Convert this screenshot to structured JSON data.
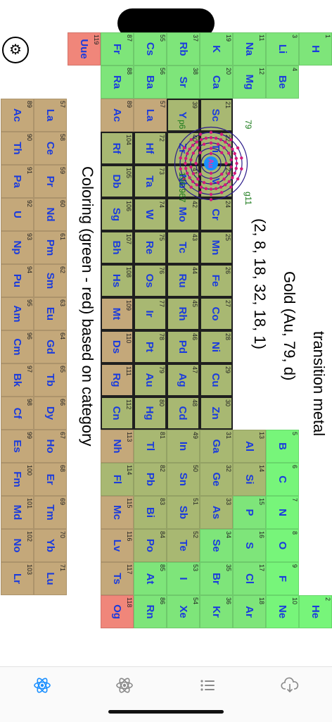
{
  "colors": {
    "green": "#7ee57a",
    "olive": "#a8b872",
    "tan": "#c4a87a",
    "salmon": "#f0867a",
    "brightgreen": "#77f57a",
    "highlightgreen": "#bfd07e",
    "accent": "#1a8fff",
    "symbol": "#1a3bdd"
  },
  "settings": {
    "icon": "gear-icon",
    "glyph": "⚙"
  },
  "selected": {
    "category": "transition metal",
    "title": "Gold (Au, 79, d)",
    "config": "(2, 8, 18, 32, 18, 1)",
    "atom": {
      "symbol": "Au",
      "number": "79",
      "mass": "196.967",
      "period": "p6",
      "group": "g11",
      "shells": [
        2,
        8,
        18,
        32,
        18,
        1
      ]
    }
  },
  "legend": "Coloring (green - red) based on category",
  "elements": [
    {
      "n": "1",
      "s": "H",
      "c": "green"
    },
    {
      "n": "2",
      "s": "He",
      "c": "brightgreen"
    },
    {
      "n": "3",
      "s": "Li",
      "c": "green"
    },
    {
      "n": "4",
      "s": "Be",
      "c": "green"
    },
    {
      "n": "5",
      "s": "B",
      "c": "brightgreen"
    },
    {
      "n": "6",
      "s": "C",
      "c": "brightgreen"
    },
    {
      "n": "7",
      "s": "N",
      "c": "brightgreen"
    },
    {
      "n": "8",
      "s": "O",
      "c": "brightgreen"
    },
    {
      "n": "9",
      "s": "F",
      "c": "brightgreen"
    },
    {
      "n": "10",
      "s": "Ne",
      "c": "brightgreen"
    },
    {
      "n": "11",
      "s": "Na",
      "c": "green"
    },
    {
      "n": "12",
      "s": "Mg",
      "c": "green"
    },
    {
      "n": "13",
      "s": "Al",
      "c": "olive"
    },
    {
      "n": "14",
      "s": "Si",
      "c": "olive"
    },
    {
      "n": "15",
      "s": "P",
      "c": "green"
    },
    {
      "n": "16",
      "s": "S",
      "c": "green"
    },
    {
      "n": "17",
      "s": "Cl",
      "c": "green"
    },
    {
      "n": "18",
      "s": "Ar",
      "c": "green"
    },
    {
      "n": "19",
      "s": "K",
      "c": "green"
    },
    {
      "n": "20",
      "s": "Ca",
      "c": "green"
    },
    {
      "n": "21",
      "s": "Sc",
      "c": "olive"
    },
    {
      "n": "22",
      "s": "Ti",
      "c": "olive"
    },
    {
      "n": "23",
      "s": "V",
      "c": "olive"
    },
    {
      "n": "24",
      "s": "Cr",
      "c": "olive"
    },
    {
      "n": "25",
      "s": "Mn",
      "c": "olive"
    },
    {
      "n": "26",
      "s": "Fe",
      "c": "olive"
    },
    {
      "n": "27",
      "s": "Co",
      "c": "olive"
    },
    {
      "n": "28",
      "s": "Ni",
      "c": "olive"
    },
    {
      "n": "29",
      "s": "Cu",
      "c": "olive"
    },
    {
      "n": "30",
      "s": "Zn",
      "c": "olive"
    },
    {
      "n": "31",
      "s": "Ga",
      "c": "olive"
    },
    {
      "n": "32",
      "s": "Ge",
      "c": "olive"
    },
    {
      "n": "33",
      "s": "As",
      "c": "olive"
    },
    {
      "n": "34",
      "s": "Se",
      "c": "green"
    },
    {
      "n": "35",
      "s": "Br",
      "c": "green"
    },
    {
      "n": "36",
      "s": "Kr",
      "c": "green"
    },
    {
      "n": "37",
      "s": "Rb",
      "c": "green"
    },
    {
      "n": "38",
      "s": "Sr",
      "c": "green"
    },
    {
      "n": "39",
      "s": "Y",
      "c": "olive"
    },
    {
      "n": "40",
      "s": "Zr",
      "c": "olive"
    },
    {
      "n": "41",
      "s": "Nb",
      "c": "olive"
    },
    {
      "n": "42",
      "s": "Mo",
      "c": "olive"
    },
    {
      "n": "43",
      "s": "Tc",
      "c": "olive"
    },
    {
      "n": "44",
      "s": "Ru",
      "c": "olive"
    },
    {
      "n": "45",
      "s": "Rh",
      "c": "olive"
    },
    {
      "n": "46",
      "s": "Pd",
      "c": "olive"
    },
    {
      "n": "47",
      "s": "Ag",
      "c": "olive"
    },
    {
      "n": "48",
      "s": "Cd",
      "c": "olive"
    },
    {
      "n": "49",
      "s": "In",
      "c": "olive"
    },
    {
      "n": "50",
      "s": "Sn",
      "c": "olive"
    },
    {
      "n": "51",
      "s": "Sb",
      "c": "olive"
    },
    {
      "n": "52",
      "s": "Te",
      "c": "olive"
    },
    {
      "n": "53",
      "s": "I",
      "c": "green"
    },
    {
      "n": "54",
      "s": "Xe",
      "c": "green"
    },
    {
      "n": "55",
      "s": "Cs",
      "c": "green"
    },
    {
      "n": "56",
      "s": "Ba",
      "c": "green"
    },
    {
      "n": "57",
      "s": "La",
      "c": "tan"
    },
    {
      "n": "72",
      "s": "Hf",
      "c": "olive"
    },
    {
      "n": "73",
      "s": "Ta",
      "c": "olive"
    },
    {
      "n": "74",
      "s": "W",
      "c": "olive"
    },
    {
      "n": "75",
      "s": "Re",
      "c": "olive"
    },
    {
      "n": "76",
      "s": "Os",
      "c": "olive"
    },
    {
      "n": "77",
      "s": "Ir",
      "c": "olive"
    },
    {
      "n": "78",
      "s": "Pt",
      "c": "olive"
    },
    {
      "n": "79",
      "s": "Au",
      "c": "olive"
    },
    {
      "n": "80",
      "s": "Hg",
      "c": "olive"
    },
    {
      "n": "81",
      "s": "Tl",
      "c": "olive"
    },
    {
      "n": "82",
      "s": "Pb",
      "c": "olive"
    },
    {
      "n": "83",
      "s": "Bi",
      "c": "olive"
    },
    {
      "n": "84",
      "s": "Po",
      "c": "olive"
    },
    {
      "n": "85",
      "s": "At",
      "c": "green"
    },
    {
      "n": "86",
      "s": "Rn",
      "c": "green"
    },
    {
      "n": "87",
      "s": "Fr",
      "c": "green"
    },
    {
      "n": "88",
      "s": "Ra",
      "c": "green"
    },
    {
      "n": "89",
      "s": "Ac",
      "c": "tan"
    },
    {
      "n": "104",
      "s": "Rf",
      "c": "olive"
    },
    {
      "n": "105",
      "s": "Db",
      "c": "olive"
    },
    {
      "n": "106",
      "s": "Sg",
      "c": "olive"
    },
    {
      "n": "107",
      "s": "Bh",
      "c": "olive"
    },
    {
      "n": "108",
      "s": "Hs",
      "c": "olive"
    },
    {
      "n": "109",
      "s": "Mt",
      "c": "tan"
    },
    {
      "n": "110",
      "s": "Ds",
      "c": "tan"
    },
    {
      "n": "111",
      "s": "Rg",
      "c": "tan"
    },
    {
      "n": "112",
      "s": "Cn",
      "c": "olive"
    },
    {
      "n": "113",
      "s": "Nh",
      "c": "tan"
    },
    {
      "n": "114",
      "s": "Fl",
      "c": "olive"
    },
    {
      "n": "115",
      "s": "Mc",
      "c": "tan"
    },
    {
      "n": "116",
      "s": "Lv",
      "c": "tan"
    },
    {
      "n": "117",
      "s": "Ts",
      "c": "tan"
    },
    {
      "n": "118",
      "s": "Og",
      "c": "salmon"
    },
    {
      "n": "119",
      "s": "Uue",
      "c": "salmon"
    },
    {
      "n": "57",
      "s": "La",
      "c": "tan"
    },
    {
      "n": "58",
      "s": "Ce",
      "c": "tan"
    },
    {
      "n": "59",
      "s": "Pr",
      "c": "tan"
    },
    {
      "n": "60",
      "s": "Nd",
      "c": "tan"
    },
    {
      "n": "61",
      "s": "Pm",
      "c": "tan"
    },
    {
      "n": "62",
      "s": "Sm",
      "c": "tan"
    },
    {
      "n": "63",
      "s": "Eu",
      "c": "tan"
    },
    {
      "n": "64",
      "s": "Gd",
      "c": "tan"
    },
    {
      "n": "65",
      "s": "Tb",
      "c": "tan"
    },
    {
      "n": "66",
      "s": "Dy",
      "c": "tan"
    },
    {
      "n": "67",
      "s": "Ho",
      "c": "tan"
    },
    {
      "n": "68",
      "s": "Er",
      "c": "tan"
    },
    {
      "n": "69",
      "s": "Tm",
      "c": "tan"
    },
    {
      "n": "70",
      "s": "Yb",
      "c": "tan"
    },
    {
      "n": "71",
      "s": "Lu",
      "c": "tan"
    },
    {
      "n": "89",
      "s": "Ac",
      "c": "tan"
    },
    {
      "n": "90",
      "s": "Th",
      "c": "tan"
    },
    {
      "n": "91",
      "s": "Pa",
      "c": "tan"
    },
    {
      "n": "92",
      "s": "U",
      "c": "tan"
    },
    {
      "n": "93",
      "s": "Np",
      "c": "tan"
    },
    {
      "n": "94",
      "s": "Pu",
      "c": "tan"
    },
    {
      "n": "95",
      "s": "Am",
      "c": "tan"
    },
    {
      "n": "96",
      "s": "Cm",
      "c": "tan"
    },
    {
      "n": "97",
      "s": "Bk",
      "c": "tan"
    },
    {
      "n": "98",
      "s": "Cf",
      "c": "tan"
    },
    {
      "n": "99",
      "s": "Es",
      "c": "tan"
    },
    {
      "n": "100",
      "s": "Fm",
      "c": "tan"
    },
    {
      "n": "101",
      "s": "Md",
      "c": "tan"
    },
    {
      "n": "102",
      "s": "No",
      "c": "tan"
    },
    {
      "n": "103",
      "s": "Lr",
      "c": "tan"
    }
  ],
  "tabs": [
    {
      "name": "tab-periodic-table",
      "icon": "atom-icon",
      "active": true
    },
    {
      "name": "tab-atom",
      "icon": "atom-outline-icon",
      "active": false
    },
    {
      "name": "tab-list",
      "icon": "list-icon",
      "active": false
    },
    {
      "name": "tab-download",
      "icon": "cloud-download-icon",
      "active": false
    }
  ]
}
